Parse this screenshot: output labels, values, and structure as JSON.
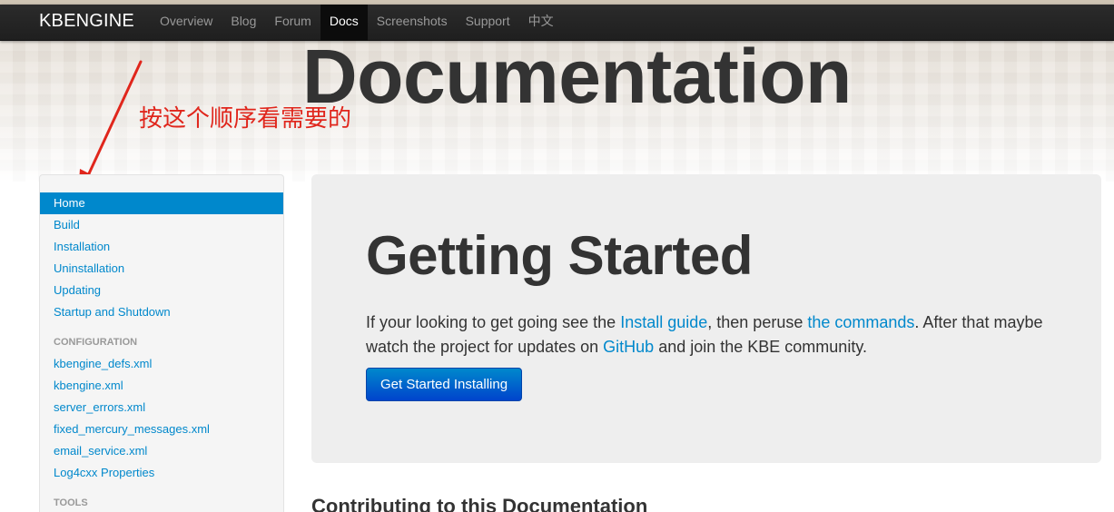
{
  "navbar": {
    "brand": "KBENGINE",
    "items": [
      {
        "label": "Overview",
        "active": false
      },
      {
        "label": "Blog",
        "active": false
      },
      {
        "label": "Forum",
        "active": false
      },
      {
        "label": "Docs",
        "active": true
      },
      {
        "label": "Screenshots",
        "active": false
      },
      {
        "label": "Support",
        "active": false
      },
      {
        "label": "中文",
        "active": false
      }
    ]
  },
  "hero": {
    "title": "Documentation"
  },
  "annotation": {
    "text": "按这个顺序看需要的",
    "color": "#e0261c"
  },
  "sidebar": {
    "items": [
      {
        "label": "Home",
        "active": true
      },
      {
        "label": "Build"
      },
      {
        "label": "Installation"
      },
      {
        "label": "Uninstallation"
      },
      {
        "label": "Updating"
      },
      {
        "label": "Startup and Shutdown"
      }
    ],
    "config_header": "CONFIGURATION",
    "config_items": [
      {
        "label": "kbengine_defs.xml"
      },
      {
        "label": "kbengine.xml"
      },
      {
        "label": "server_errors.xml"
      },
      {
        "label": "fixed_mercury_messages.xml"
      },
      {
        "label": "email_service.xml"
      },
      {
        "label": "Log4cxx Properties"
      }
    ],
    "tools_header": "TOOLS"
  },
  "main": {
    "heading": "Getting Started",
    "lead": {
      "part1": "If your looking to get going see the ",
      "link1": "Install guide",
      "part2": ", then peruse ",
      "link2": "the commands",
      "part3": ". After that maybe watch the project for updates on ",
      "link3": "GitHub",
      "part4": " and join the KBE community."
    },
    "button_label": "Get Started Installing",
    "section_heading": "Contributing to this Documentation"
  },
  "colors": {
    "navbar_bg": "#222222",
    "link": "#0088cc",
    "active_bg": "#0088cc",
    "button_bg": "#006dcc"
  }
}
